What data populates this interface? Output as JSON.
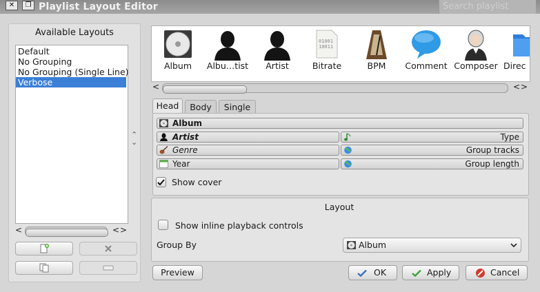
{
  "window": {
    "title": "Playlist Layout Editor",
    "search_placeholder": "Search playlist"
  },
  "left": {
    "title": "Available Layouts",
    "layouts": [
      {
        "label": "Default",
        "selected": false
      },
      {
        "label": "No Grouping",
        "selected": false
      },
      {
        "label": "No Grouping (Single Line)",
        "selected": false
      },
      {
        "label": "Verbose",
        "selected": true
      }
    ]
  },
  "tokens": [
    {
      "label": "Album",
      "icon": "cd-icon"
    },
    {
      "label": "Albu…tist",
      "icon": "person-silhouette-icon"
    },
    {
      "label": "Artist",
      "icon": "person-silhouette-icon"
    },
    {
      "label": "Bitrate",
      "icon": "binary-document-icon"
    },
    {
      "label": "BPM",
      "icon": "metronome-icon"
    },
    {
      "label": "Comment",
      "icon": "speech-bubble-icon"
    },
    {
      "label": "Composer",
      "icon": "composer-portrait-icon"
    },
    {
      "label": "Direc",
      "icon": "folder-icon"
    }
  ],
  "tabs": [
    {
      "label": "Head",
      "active": true
    },
    {
      "label": "Body",
      "active": false
    },
    {
      "label": "Single",
      "active": false
    }
  ],
  "head_rows": {
    "album": "Album",
    "artist": "Artist",
    "type": "Type",
    "genre": "Genre",
    "group_tracks": "Group tracks",
    "year": "Year",
    "group_length": "Group length"
  },
  "show_cover": {
    "label": "Show cover",
    "checked": true
  },
  "layout_box": {
    "title": "Layout",
    "inline_controls_label": "Show inline playback controls",
    "inline_controls_checked": false,
    "group_by_label": "Group By",
    "group_by_value": "Album"
  },
  "buttons": {
    "preview": "Preview",
    "ok": "OK",
    "apply": "Apply",
    "cancel": "Cancel"
  }
}
